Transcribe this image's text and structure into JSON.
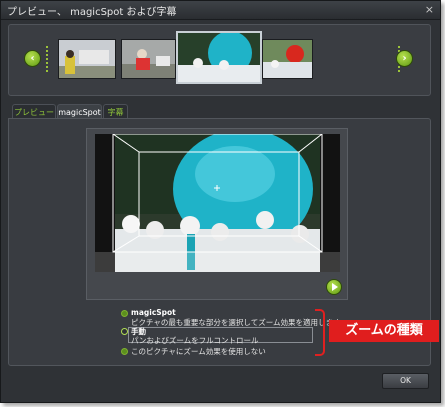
{
  "window": {
    "title": "プレビュー、 magicSpot および字幕",
    "close_glyph": "×"
  },
  "filmstrip": {
    "prev_glyph": "‹",
    "next_glyph": "›",
    "thumbnails": [
      "thumb-1",
      "thumb-2",
      "thumb-3-selected",
      "thumb-4"
    ]
  },
  "tabs": [
    {
      "label": "プレビュー",
      "active": false
    },
    {
      "label": "magicSpot",
      "active": true
    },
    {
      "label": "字幕",
      "active": false
    }
  ],
  "options": [
    {
      "title": "magicSpot",
      "desc": "ピクチャの最も重要な部分を選択してズーム効果を適用します",
      "selected": false
    },
    {
      "title": "手動",
      "desc": "パンおよびズームをフルコントロール",
      "selected": true
    },
    {
      "title": "",
      "desc": "このピクチャにズーム効果を使用しない",
      "selected": false
    }
  ],
  "callout": "ズームの種類",
  "ok_label": "OK",
  "colors": {
    "accent": "#8fc43a",
    "callout": "#e01e1e",
    "balloon": "#1fb3c8"
  }
}
